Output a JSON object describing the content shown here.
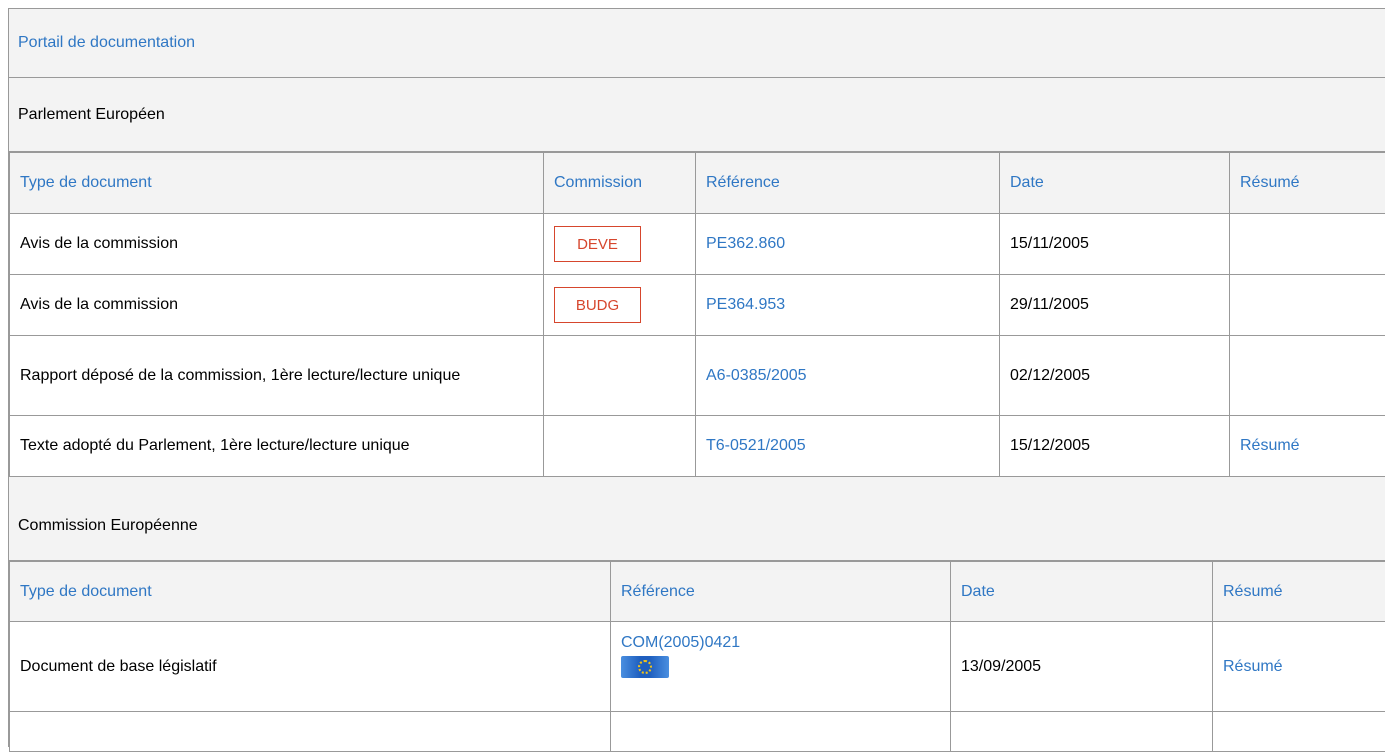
{
  "portal": {
    "title": "Portail de documentation"
  },
  "ep": {
    "title": "Parlement Européen",
    "headers": {
      "type": "Type de document",
      "commission": "Commission",
      "reference": "Référence",
      "date": "Date",
      "summary": "Résumé"
    },
    "rows": [
      {
        "type": "Avis de la commission",
        "commission": "DEVE",
        "reference": "PE362.860",
        "date": "15/11/2005",
        "summary": ""
      },
      {
        "type": "Avis de la commission",
        "commission": "BUDG",
        "reference": "PE364.953",
        "date": "29/11/2005",
        "summary": ""
      },
      {
        "type": "Rapport déposé de la commission, 1ère lecture/lecture unique",
        "commission": "",
        "reference": "A6-0385/2005",
        "date": "02/12/2005",
        "summary": ""
      },
      {
        "type": "Texte adopté du Parlement, 1ère lecture/lecture unique",
        "commission": "",
        "reference": "T6-0521/2005",
        "date": "15/12/2005",
        "summary": "Résumé"
      }
    ]
  },
  "ec": {
    "title": "Commission Européenne",
    "headers": {
      "type": "Type de document",
      "reference": "Référence",
      "date": "Date",
      "summary": "Résumé"
    },
    "rows": [
      {
        "type": "Document de base législatif",
        "reference": "COM(2005)0421",
        "date": "13/09/2005",
        "summary": "Résumé",
        "icon": "eu-flag-icon"
      }
    ]
  }
}
